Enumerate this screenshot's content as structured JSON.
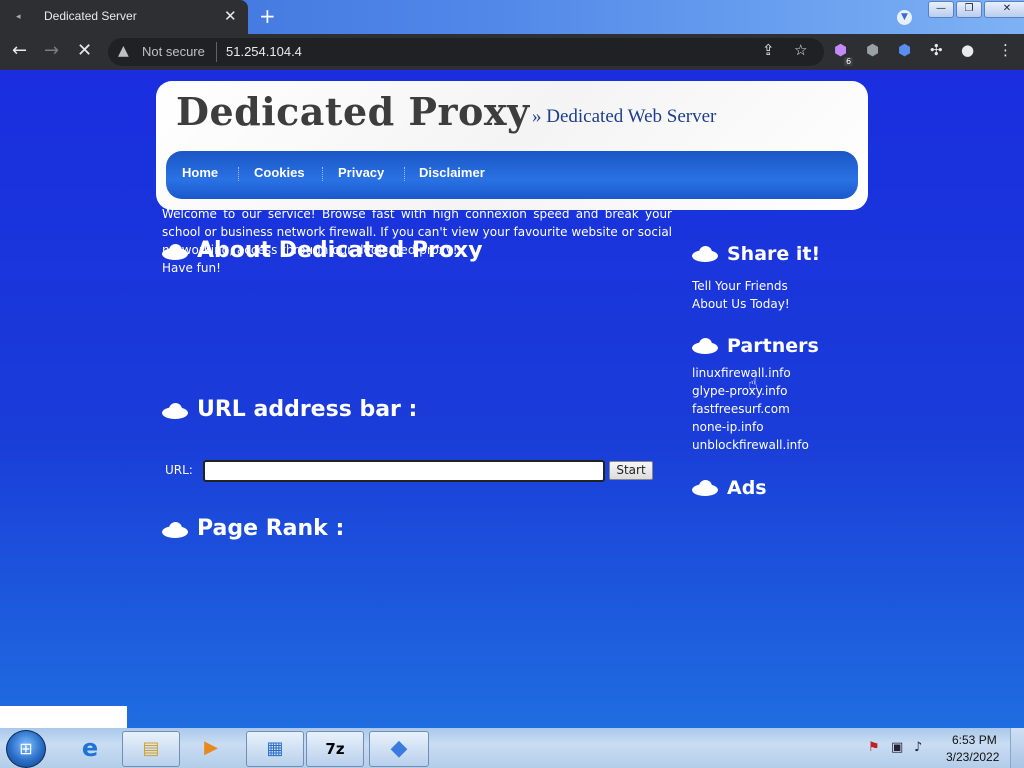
{
  "browser": {
    "tab_title": "Dedicated Server",
    "new_tab_symbol": "+",
    "close_symbol": "✕",
    "security_label": "Not secure",
    "url": "51.254.104.4",
    "extension_badge": "6",
    "window_controls": {
      "minimize": "—",
      "restore": "❐",
      "close": "✕"
    }
  },
  "site": {
    "title": "Dedicated Proxy",
    "tagline": "» Dedicated Web Server",
    "nav": [
      "Home",
      "Cookies",
      "Privacy",
      "Disclaimer"
    ]
  },
  "main": {
    "about_heading": "About Dedicated Proxy",
    "about_paragraph": "Welcome to our service! Browse fast with high connexion speed and break your school or business network firewall. If you can't view your favourite website or social networking, access through our dedicated proxy!",
    "about_closing": "Have fun!",
    "url_heading": "URL address bar :",
    "url_label": "URL:",
    "url_value": "",
    "start_button": "Start",
    "rank_heading": "Page Rank :"
  },
  "sidebar": {
    "share_heading": "Share it!",
    "share_line1": "Tell Your Friends",
    "share_line2": "About Us Today!",
    "partners_heading": "Partners",
    "partners": [
      "linuxfirewall.info",
      "glype-proxy.info",
      "fastfreesurf.com",
      "none-ip.info",
      "unblockfirewall.info"
    ],
    "ads_heading": "Ads"
  },
  "taskbar": {
    "seven_zip_label": "7z",
    "time": "6:53 PM",
    "date": "3/23/2022"
  }
}
